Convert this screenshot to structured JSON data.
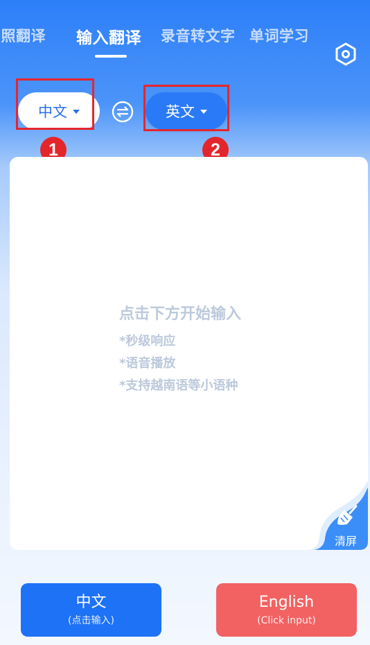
{
  "tabs": [
    {
      "label": "拍照翻译",
      "active": false
    },
    {
      "label": "输入翻译",
      "active": true
    },
    {
      "label": "录音转文字",
      "active": false
    },
    {
      "label": "单词学习",
      "active": false
    }
  ],
  "languages": {
    "source": "中文",
    "target": "英文"
  },
  "annotations": {
    "badge_1": "1",
    "badge_2": "2"
  },
  "input_card": {
    "hint_title": "点击下方开始输入",
    "hint_lines": [
      "*秒级响应",
      "*语音播放",
      "*支持越南语等小语种"
    ]
  },
  "clear_button": {
    "label": "清屏"
  },
  "bottom_buttons": {
    "chinese": {
      "label": "中文",
      "sublabel": "(点击输入)"
    },
    "english": {
      "label": "English",
      "sublabel": "(Click input)"
    }
  },
  "colors": {
    "accent": "#2a7af7",
    "annotation_red": "#e8252b",
    "english_button": "#f26262",
    "hint_text": "#bcc9dc"
  },
  "icons": [
    "hexagon-settings-icon",
    "swap-icon",
    "broom-icon",
    "caret-down-icon"
  ]
}
